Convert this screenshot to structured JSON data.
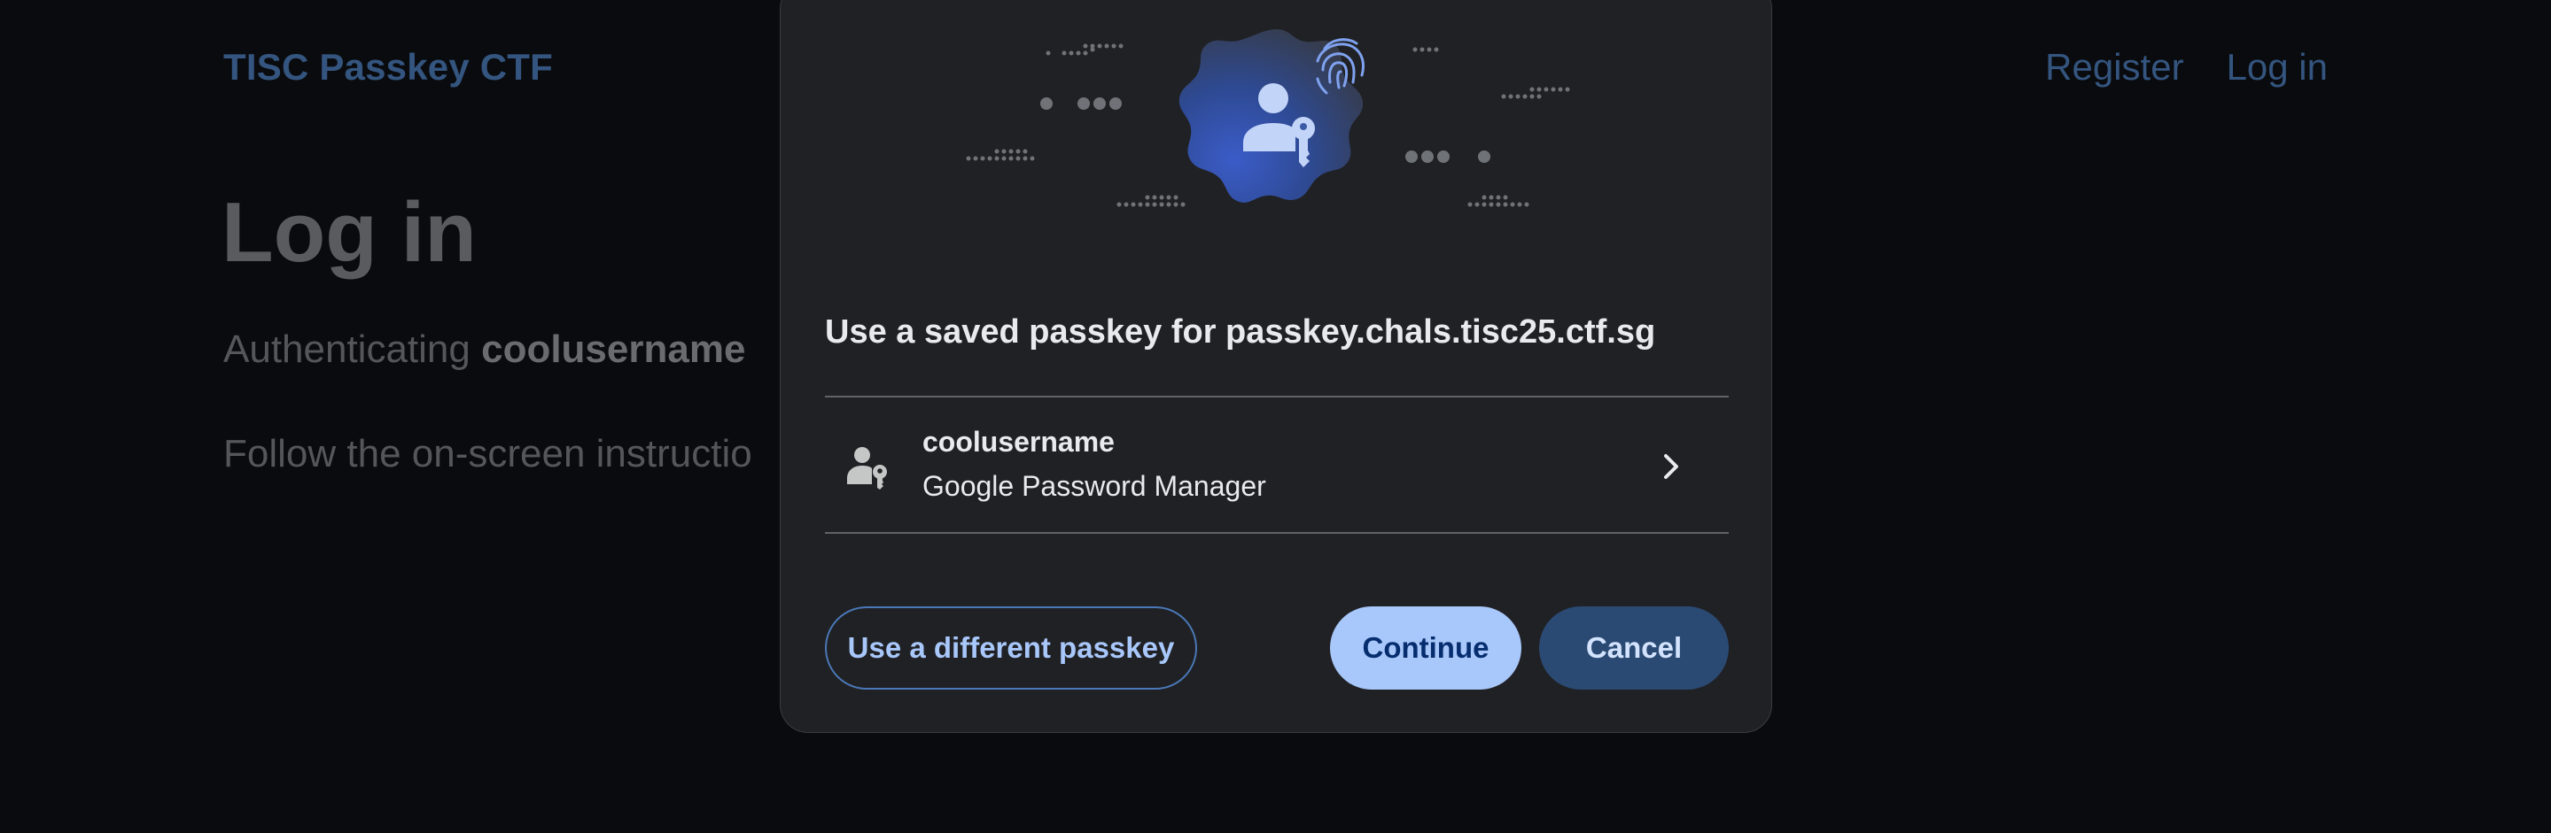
{
  "site": {
    "title": "TISC Passkey CTF",
    "nav": {
      "register": "Register",
      "login": "Log in"
    },
    "heading": "Log in",
    "authenticating_prefix": "Authenticating ",
    "authenticating_user": "coolusername",
    "follow_text": "Follow the on-screen instructio"
  },
  "dialog": {
    "title": "Use a saved passkey for passkey.chals.tisc25.ctf.sg",
    "account": {
      "username": "coolusername",
      "provider": "Google Password Manager",
      "icon": "person-key-icon",
      "action_icon": "chevron-right-icon"
    },
    "buttons": {
      "different": "Use a different passkey",
      "continue": "Continue",
      "cancel": "Cancel"
    }
  },
  "colors": {
    "page_bg": "#0a0b0e",
    "dialog_bg": "#202124",
    "link": "#34557f",
    "primary_button": "#a8c7fa",
    "tonal_button": "#2b4a73"
  }
}
